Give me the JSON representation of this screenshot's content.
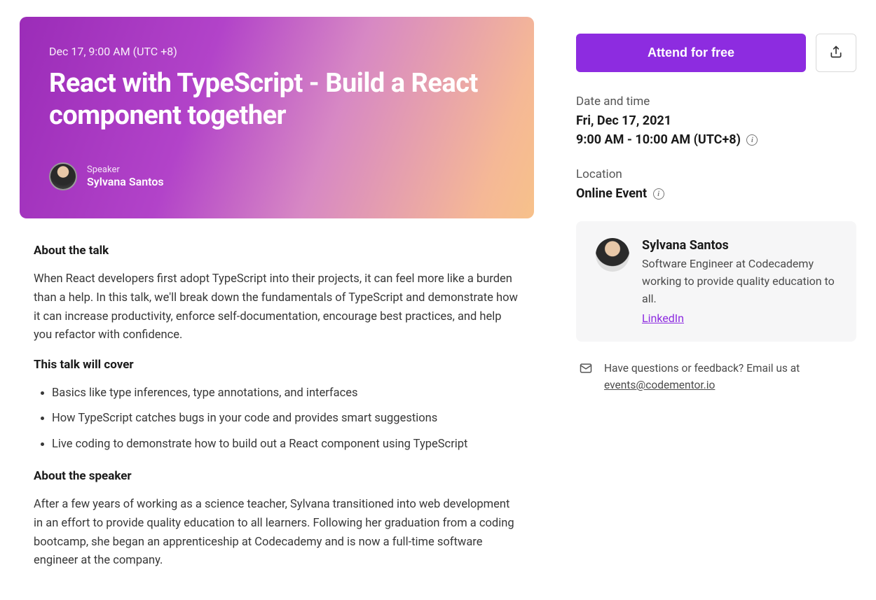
{
  "hero": {
    "date_line": "Dec 17, 9:00 AM (UTC +8)",
    "title": "React with TypeScript - Build a React component together",
    "speaker_label": "Speaker",
    "speaker_name": "Sylvana Santos"
  },
  "about": {
    "heading": "About the talk",
    "body": "When React developers first adopt TypeScript into their projects, it can feel more like a burden than a help. In this talk, we'll break down the fundamentals of TypeScript and demonstrate how it can increase productivity, enforce self-documentation, encourage best practices, and help you refactor with confidence."
  },
  "cover": {
    "heading": "This talk will cover",
    "items": [
      "Basics like type inferences, type annotations, and interfaces",
      "How TypeScript catches bugs in your code and provides smart suggestions",
      "Live coding to demonstrate how to build out a React component using TypeScript"
    ]
  },
  "speaker_about": {
    "heading": "About the speaker",
    "body": "After a few years of working as a science teacher, Sylvana transitioned into web development in an effort to provide quality education to all learners. Following her graduation from a coding bootcamp, she began an apprenticeship at Codecademy and is now a full-time software engineer at the company."
  },
  "cta": {
    "attend_label": "Attend for free"
  },
  "datetime": {
    "label": "Date and time",
    "date": "Fri, Dec 17, 2021",
    "time": "9:00 AM - 10:00 AM (UTC+8)"
  },
  "location": {
    "label": "Location",
    "value": "Online Event"
  },
  "speaker_card": {
    "name": "Sylvana Santos",
    "bio": "Software Engineer at Codecademy working to provide quality education to all.",
    "link_label": "LinkedIn"
  },
  "contact": {
    "prefix": "Have questions or feedback? Email us at ",
    "email": "events@codementor.io"
  }
}
